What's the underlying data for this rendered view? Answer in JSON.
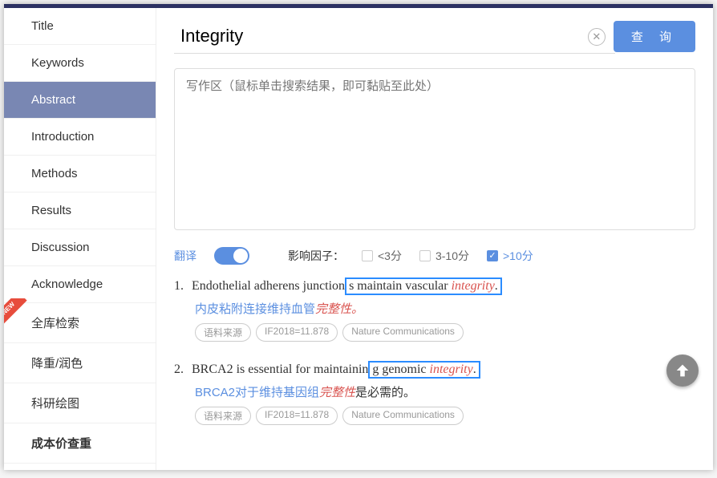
{
  "sidebar": {
    "items": [
      {
        "label": "Title"
      },
      {
        "label": "Keywords"
      },
      {
        "label": "Abstract"
      },
      {
        "label": "Introduction"
      },
      {
        "label": "Methods"
      },
      {
        "label": "Results"
      },
      {
        "label": "Discussion"
      },
      {
        "label": "Acknowledge"
      },
      {
        "label": "全库检索"
      },
      {
        "label": "降重/润色"
      },
      {
        "label": "科研绘图"
      },
      {
        "label": "成本价查重"
      }
    ],
    "new_badge": "NEW"
  },
  "search": {
    "value": "Integrity",
    "query_btn": "查 询"
  },
  "textarea": {
    "placeholder": "写作区（鼠标单击搜索结果，即可黏贴至此处）"
  },
  "filters": {
    "translate_label": "翻译",
    "if_label": "影响因子：",
    "lt3": "<3分",
    "mid": "3-10分",
    "gt10": ">10分"
  },
  "results": [
    {
      "num": "1.",
      "en_pre": "Endothelial adherens junction",
      "en_box": "s maintain vascular ",
      "en_kw": "integrity",
      "en_post": ".",
      "zh_pre": "内皮粘附连接维持血管",
      "zh_kw": "完整性",
      "zh_post": "。",
      "zh_tail": "",
      "tags": [
        "语料来源",
        "IF2018=11.878",
        "Nature Communications"
      ]
    },
    {
      "num": "2.",
      "en_pre": "BRCA2 is essential for maintainin",
      "en_box": "g genomic ",
      "en_kw": "integrity",
      "en_post": ".",
      "zh_pre": "BRCA2对于维持基因组",
      "zh_kw": "完整性",
      "zh_post": "",
      "zh_tail": "是必需的。",
      "tags": [
        "语料来源",
        "IF2018=11.878",
        "Nature Communications"
      ]
    }
  ]
}
